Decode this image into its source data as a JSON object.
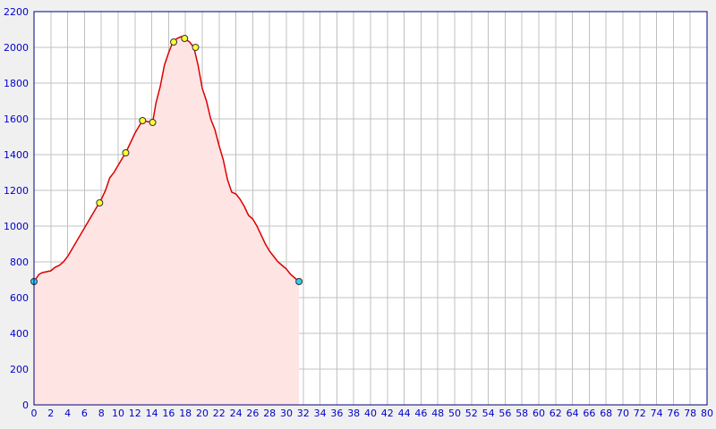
{
  "chart_data": {
    "type": "area",
    "title": "",
    "xlabel": "",
    "ylabel": "",
    "xlim": [
      0,
      80
    ],
    "ylim": [
      0,
      2200
    ],
    "x_ticks": [
      0,
      2,
      4,
      6,
      8,
      10,
      12,
      14,
      16,
      18,
      20,
      22,
      24,
      26,
      28,
      30,
      32,
      34,
      36,
      38,
      40,
      42,
      44,
      46,
      48,
      50,
      52,
      54,
      56,
      58,
      60,
      62,
      64,
      66,
      68,
      70,
      72,
      74,
      76,
      78,
      80
    ],
    "y_ticks": [
      0,
      200,
      400,
      600,
      800,
      1000,
      1200,
      1400,
      1600,
      1800,
      2000,
      2200
    ],
    "grid": true,
    "colors": {
      "line": "#dd0000",
      "fill": "#ffe4e4",
      "waypoint": "#ffff33",
      "endpoint": "#33ccee",
      "grid": "#c0c0c0",
      "axis_text": "#0000cc",
      "frame": "#000080"
    },
    "series": [
      {
        "x": [
          0,
          0.3,
          0.6,
          1.0,
          1.5,
          2.0,
          2.5,
          3.0,
          3.5,
          4.0,
          4.5,
          5.0,
          5.5,
          6.0,
          6.5,
          7.0,
          7.5,
          7.8,
          8.5,
          9.0,
          9.5,
          10.0,
          10.5,
          10.9,
          11.5,
          12.0,
          12.5,
          12.9,
          13.5,
          14.1,
          14.5,
          15.0,
          15.5,
          16.0,
          16.5,
          17.0,
          17.5,
          17.9,
          18.5,
          19.0,
          19.5,
          20.0,
          20.5,
          21.0,
          21.5,
          22.0,
          22.5,
          23.0,
          23.5,
          24.0,
          24.5,
          25.0,
          25.5,
          26.0,
          26.5,
          27.0,
          27.5,
          28.0,
          28.5,
          29.0,
          29.5,
          30.0,
          30.5,
          31.0,
          31.5
        ],
        "y": [
          690,
          710,
          730,
          740,
          745,
          750,
          770,
          780,
          800,
          830,
          870,
          910,
          950,
          990,
          1030,
          1070,
          1110,
          1130,
          1200,
          1270,
          1300,
          1340,
          1380,
          1410,
          1470,
          1520,
          1560,
          1590,
          1585,
          1580,
          1690,
          1780,
          1900,
          1970,
          2030,
          2050,
          2060,
          2050,
          2030,
          2000,
          1900,
          1770,
          1700,
          1600,
          1540,
          1450,
          1370,
          1260,
          1190,
          1180,
          1150,
          1110,
          1060,
          1040,
          1000,
          950,
          900,
          860,
          830,
          800,
          780,
          760,
          730,
          710,
          690
        ]
      }
    ],
    "waypoints": [
      {
        "x": 7.8,
        "y": 1130,
        "kind": "waypoint"
      },
      {
        "x": 10.9,
        "y": 1410,
        "kind": "waypoint"
      },
      {
        "x": 12.9,
        "y": 1590,
        "kind": "waypoint"
      },
      {
        "x": 14.1,
        "y": 1580,
        "kind": "waypoint"
      },
      {
        "x": 16.6,
        "y": 2030,
        "kind": "waypoint"
      },
      {
        "x": 17.9,
        "y": 2050,
        "kind": "waypoint"
      },
      {
        "x": 19.2,
        "y": 2000,
        "kind": "waypoint"
      },
      {
        "x": 0,
        "y": 690,
        "kind": "endpoint"
      },
      {
        "x": 31.5,
        "y": 690,
        "kind": "endpoint"
      }
    ]
  }
}
